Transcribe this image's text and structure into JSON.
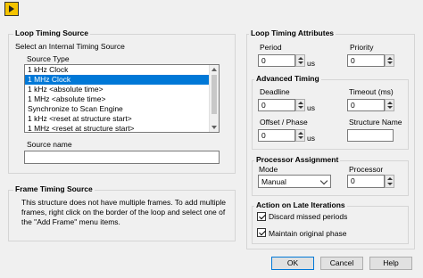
{
  "window": {
    "icon": "labview-warning-icon"
  },
  "loop_source": {
    "title": "Loop Timing Source",
    "select_label": "Select an Internal Timing Source",
    "source_type_label": "Source Type",
    "source_types": [
      "1 kHz Clock",
      "1 MHz Clock",
      "1 kHz <absolute time>",
      "1 MHz <absolute time>",
      "Synchronize to Scan Engine",
      "1 kHz <reset at structure start>",
      "1 MHz <reset at structure start>"
    ],
    "selected_index": 1,
    "source_name_label": "Source name",
    "source_name_value": ""
  },
  "frame_source": {
    "title": "Frame Timing Source",
    "text": "This structure does not have multiple frames. To add multiple frames, right click on the border of the loop and select one of the \"Add Frame\" menu items."
  },
  "attributes": {
    "title": "Loop Timing Attributes",
    "period_label": "Period",
    "period_value": "0",
    "period_unit": "us",
    "priority_label": "Priority",
    "priority_value": "0",
    "advanced_title": "Advanced Timing",
    "deadline_label": "Deadline",
    "deadline_value": "0",
    "deadline_unit": "us",
    "timeout_label": "Timeout (ms)",
    "timeout_value": "0",
    "offset_label": "Offset / Phase",
    "offset_value": "0",
    "offset_unit": "us",
    "structure_name_label": "Structure Name",
    "structure_name_value": ""
  },
  "processor": {
    "title": "Processor Assignment",
    "mode_label": "Mode",
    "mode_value": "Manual",
    "processor_label": "Processor",
    "processor_value": "0"
  },
  "late": {
    "title": "Action on Late Iterations",
    "discard_label": "Discard missed periods",
    "discard_checked": true,
    "maintain_label": "Maintain original phase",
    "maintain_checked": true
  },
  "buttons": {
    "ok": "OK",
    "cancel": "Cancel",
    "help": "Help"
  }
}
